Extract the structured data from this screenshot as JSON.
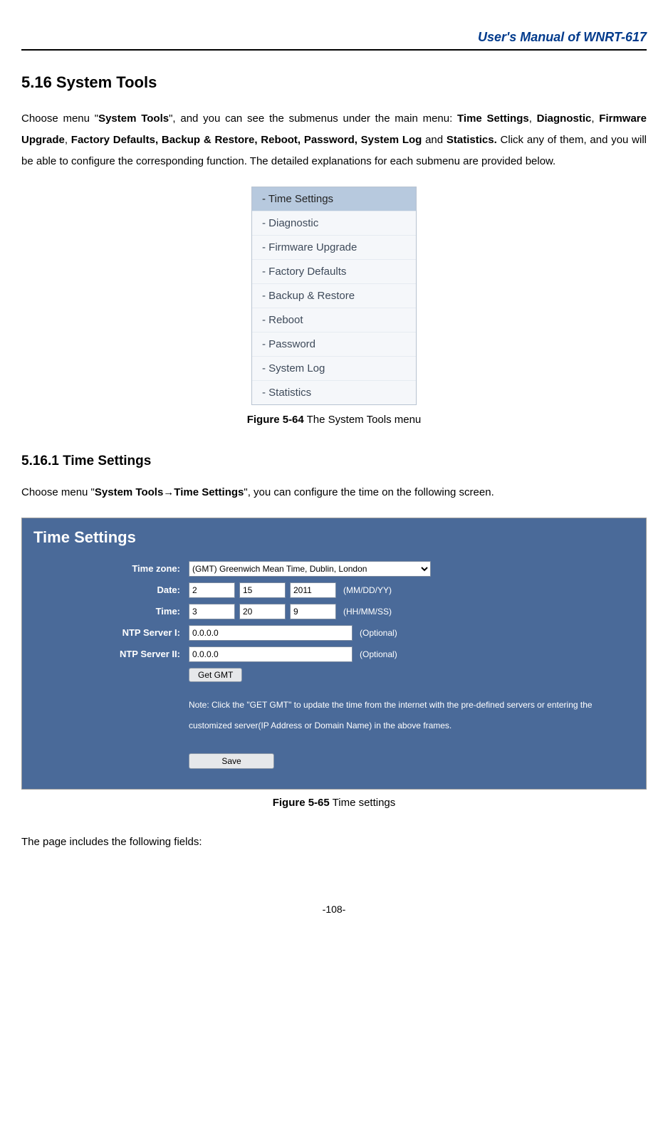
{
  "header": {
    "manual_title": "User's Manual of WNRT-617"
  },
  "section": {
    "number_title": "5.16  System Tools",
    "intro_pre": "Choose menu \"",
    "intro_bold1": "System Tools",
    "intro_mid": "\", and you can see the submenus under the main menu: ",
    "intro_list": "Time Settings",
    "intro_mid2": ", ",
    "intro_bold2": "Diagnostic",
    "intro_mid3": ", ",
    "intro_bold3": "Firmware Upgrade",
    "intro_mid4": ", ",
    "intro_bold4": "Factory Defaults, Backup & Restore, Reboot, Password, System Log",
    "intro_mid5": " and ",
    "intro_bold5": "Statistics.",
    "intro_post": " Click any of them, and you will be able to configure the corresponding function. The detailed explanations for each submenu are provided below."
  },
  "menu": {
    "items": [
      "- Time Settings",
      "- Diagnostic",
      "- Firmware Upgrade",
      "- Factory Defaults",
      "- Backup & Restore",
      "- Reboot",
      "- Password",
      "- System Log",
      "- Statistics"
    ]
  },
  "fig1": {
    "label": "Figure 5-64",
    "caption": " The System Tools menu"
  },
  "subsection": {
    "title": "5.16.1 Time Settings",
    "intro_pre": "Choose menu \"",
    "intro_bold": "System Tools→Time Settings",
    "intro_post": "\", you can configure the time on the following screen."
  },
  "settings": {
    "panel_title": "Time Settings",
    "labels": {
      "timezone": "Time zone:",
      "date": "Date:",
      "time": "Time:",
      "ntp1": "NTP Server I:",
      "ntp2": "NTP Server II:"
    },
    "timezone_value": "(GMT) Greenwich Mean Time, Dublin, London",
    "date": {
      "mm": "2",
      "dd": "15",
      "yy": "2011",
      "hint": "(MM/DD/YY)"
    },
    "time": {
      "hh": "3",
      "mm": "20",
      "ss": "9",
      "hint": "(HH/MM/SS)"
    },
    "ntp1": {
      "value": "0.0.0.0",
      "hint": "(Optional)"
    },
    "ntp2": {
      "value": "0.0.0.0",
      "hint": "(Optional)"
    },
    "get_gmt": "Get GMT",
    "note": "Note: Click the \"GET GMT\" to update the time from the internet with the pre-defined servers or entering the customized server(IP Address or Domain Name) in the above frames.",
    "save": "Save"
  },
  "fig2": {
    "label": "Figure 5-65",
    "caption": "    Time settings"
  },
  "trailing": "The page includes the following fields:",
  "footer": {
    "page": "-108-"
  }
}
